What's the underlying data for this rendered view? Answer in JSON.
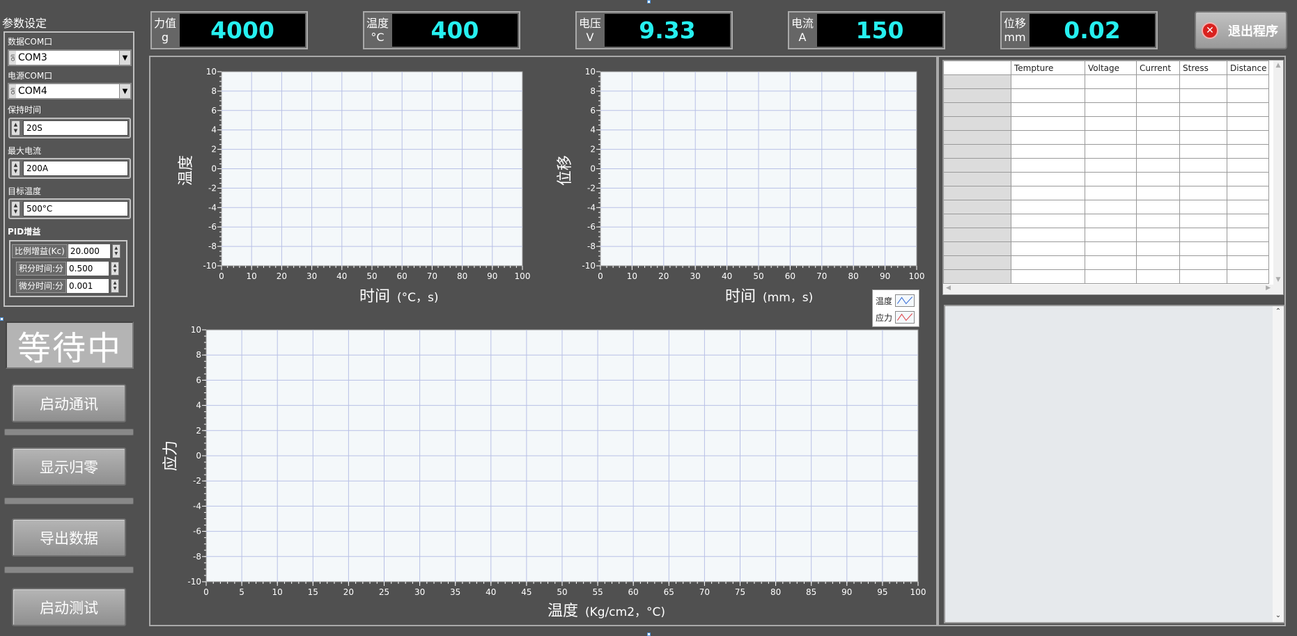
{
  "sidebar": {
    "section_title": "参数设定",
    "data_com_label": "数据COM口",
    "data_com_value": "COM3",
    "power_com_label": "电源COM口",
    "power_com_value": "COM4",
    "hold_time_label": "保持时间",
    "hold_time_value": "20S",
    "max_current_label": "最大电流",
    "max_current_value": "200A",
    "target_temp_label": "目标温度",
    "target_temp_value": "500°C",
    "pid_label": "PID增益",
    "pid": [
      {
        "label": "比例增益(Kc)",
        "value": "20.000"
      },
      {
        "label": "积分时间:分",
        "value": "0.500"
      },
      {
        "label": "微分时间:分",
        "value": "0.001"
      }
    ],
    "status_text": "等待中",
    "buttons": {
      "start_comm": "启动通讯",
      "display_zero": "显示归零",
      "export_data": "导出数据",
      "start_test": "启动测试"
    }
  },
  "indicators": [
    {
      "label1": "力值",
      "label2": "g",
      "value": "4000"
    },
    {
      "label1": "温度",
      "label2": "°C",
      "value": "400"
    },
    {
      "label1": "电压",
      "label2": "V",
      "value": "9.33"
    },
    {
      "label1": "电流",
      "label2": "A",
      "value": "150"
    },
    {
      "label1": "位移",
      "label2": "mm",
      "value": "0.02"
    }
  ],
  "exit_button": "退出程序",
  "table": {
    "columns": [
      "",
      "Tempture",
      "Voltage",
      "Current",
      "Stress",
      "Distance"
    ],
    "row_count": 15
  },
  "legend": [
    {
      "name": "温度",
      "color": "#3a6fd8"
    },
    {
      "name": "应力",
      "color": "#e0444a"
    }
  ],
  "chart_data": [
    {
      "type": "line",
      "ylabel": "温度",
      "xlabel": "时间",
      "xunit": "(°C，s)",
      "xlim": [
        0,
        100
      ],
      "ylim": [
        -10,
        10
      ],
      "xticks": [
        0,
        10,
        20,
        30,
        40,
        50,
        60,
        70,
        80,
        90,
        100
      ],
      "yticks": [
        10,
        8,
        6,
        4,
        2,
        0,
        -2,
        -4,
        -6,
        -8,
        -10
      ],
      "series": []
    },
    {
      "type": "line",
      "ylabel": "位移",
      "xlabel": "时间",
      "xunit": "(mm，s)",
      "xlim": [
        0,
        100
      ],
      "ylim": [
        -10,
        10
      ],
      "xticks": [
        0,
        10,
        20,
        30,
        40,
        50,
        60,
        70,
        80,
        90,
        100
      ],
      "yticks": [
        10,
        8,
        6,
        4,
        2,
        0,
        -2,
        -4,
        -6,
        -8,
        -10
      ],
      "series": []
    },
    {
      "type": "line",
      "ylabel": "应力",
      "xlabel": "温度",
      "xunit": "(Kg/cm2，°C)",
      "xlim": [
        0,
        100
      ],
      "ylim": [
        -10,
        10
      ],
      "xticks": [
        0,
        5,
        10,
        15,
        20,
        25,
        30,
        35,
        40,
        45,
        50,
        55,
        60,
        65,
        70,
        75,
        80,
        85,
        90,
        95,
        100
      ],
      "yticks": [
        10,
        8,
        6,
        4,
        2,
        0,
        -2,
        -4,
        -6,
        -8,
        -10
      ],
      "series": []
    }
  ]
}
